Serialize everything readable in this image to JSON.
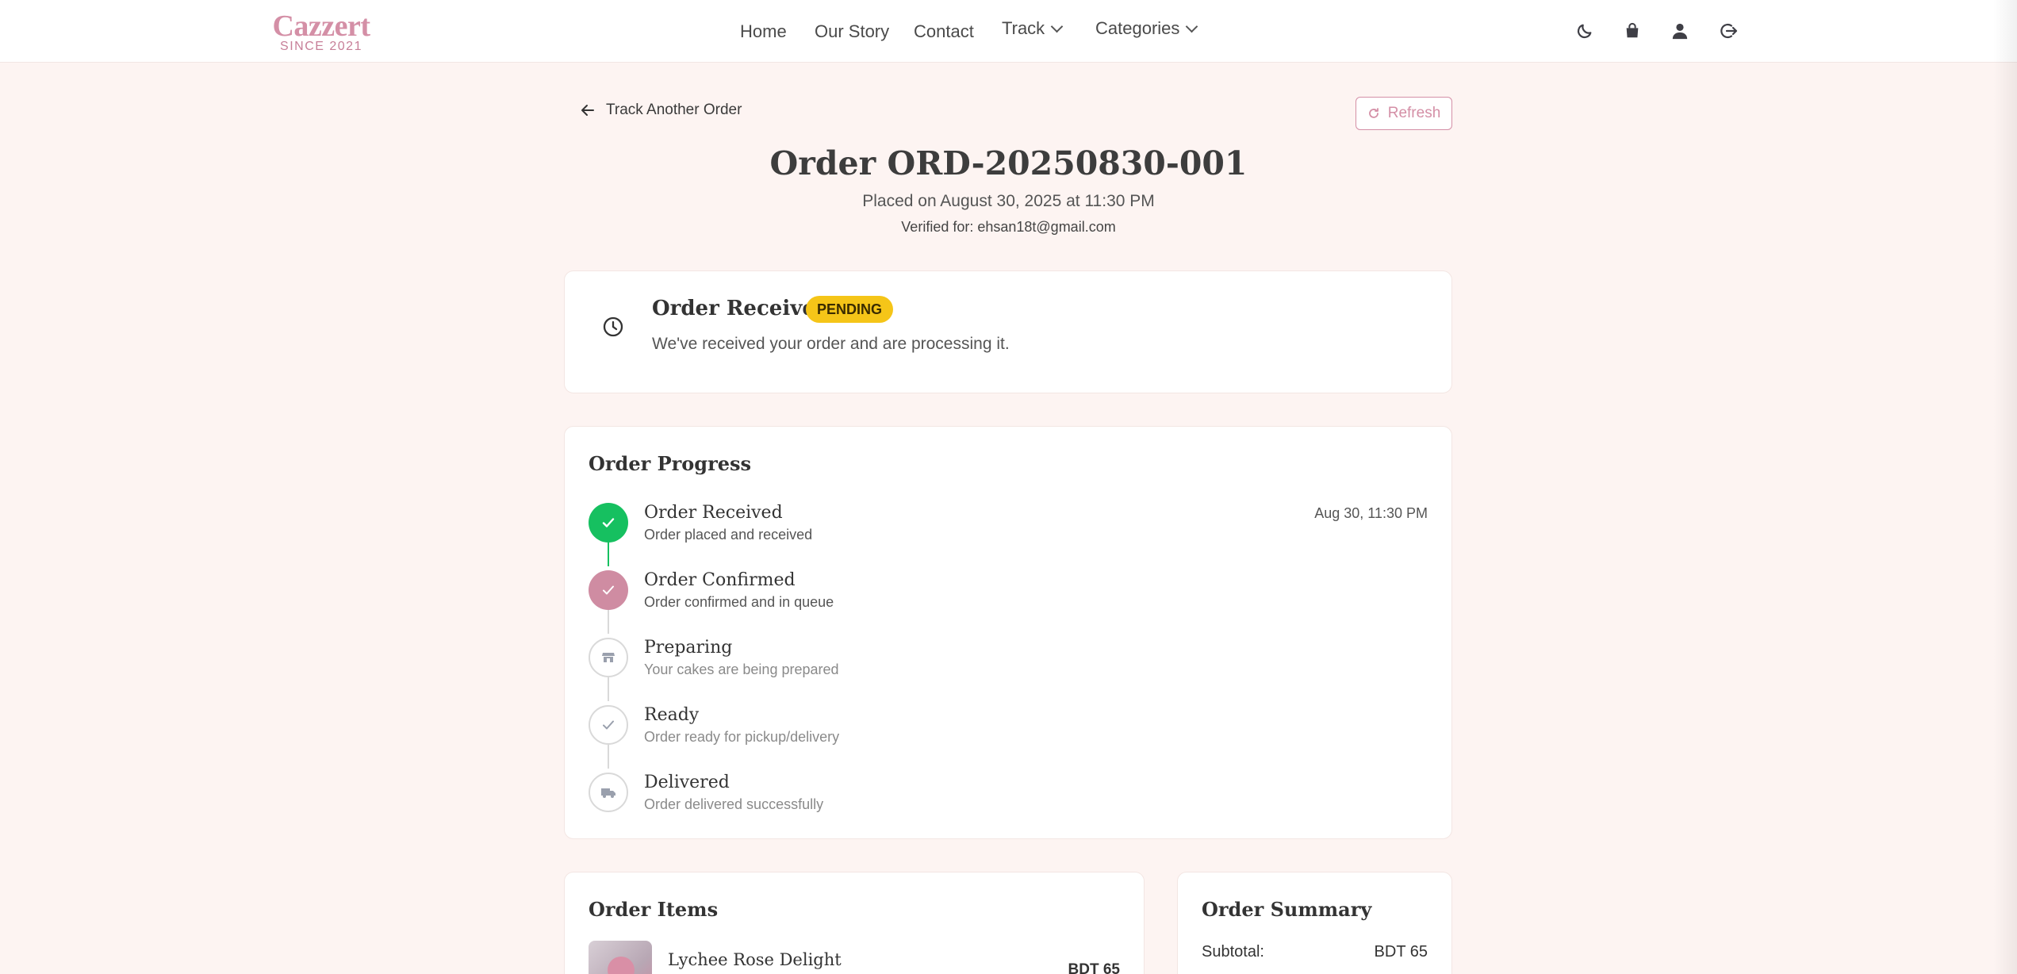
{
  "brand": {
    "name": "Cazzert",
    "since": "SINCE 2021"
  },
  "nav": {
    "home": "Home",
    "story": "Our Story",
    "contact": "Contact",
    "track": "Track",
    "categories": "Categories"
  },
  "header_icons": [
    "moon-icon",
    "shopping-bag-icon",
    "user-icon",
    "logout-icon"
  ],
  "actions": {
    "back": "Track Another Order",
    "refresh": "Refresh"
  },
  "order": {
    "title": "Order ORD-20250830-001",
    "placed": "Placed on August 30, 2025 at 11:30 PM",
    "verified": "Verified for: ehsan18t@gmail.com"
  },
  "status": {
    "title": "Order Received",
    "badge": "PENDING",
    "description": "We've received your order and are processing it."
  },
  "progress": {
    "title": "Order Progress",
    "steps": [
      {
        "title": "Order Received",
        "desc": "Order placed and received",
        "time": "Aug 30, 11:30 PM",
        "state": "done"
      },
      {
        "title": "Order Confirmed",
        "desc": "Order confirmed and in queue",
        "time": "",
        "state": "current"
      },
      {
        "title": "Preparing",
        "desc": "Your cakes are being prepared",
        "time": "",
        "state": "pending"
      },
      {
        "title": "Ready",
        "desc": "Order ready for pickup/delivery",
        "time": "",
        "state": "pending"
      },
      {
        "title": "Delivered",
        "desc": "Order delivered successfully",
        "time": "",
        "state": "pending"
      }
    ]
  },
  "items": {
    "title": "Order Items",
    "list": [
      {
        "name": "Lychee Rose Delight",
        "price": "BDT 65"
      }
    ]
  },
  "summary": {
    "title": "Order Summary",
    "subtotal_label": "Subtotal:",
    "subtotal_value": "BDT 65"
  },
  "colors": {
    "accent": "#d48fa6",
    "success": "#16c060",
    "badge": "#f5c518",
    "background": "#fdf4f2"
  }
}
